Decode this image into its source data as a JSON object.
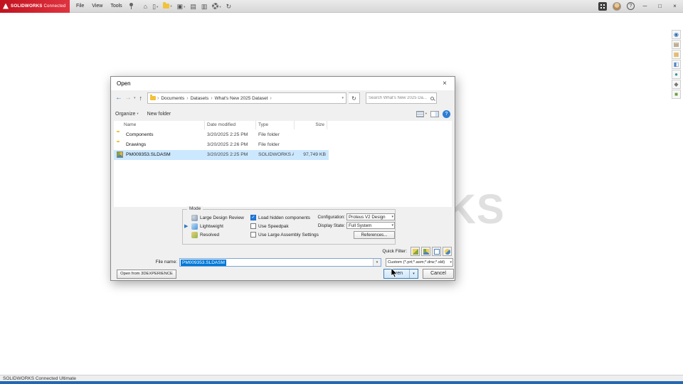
{
  "colors": {
    "accent_blue": "#0078d7",
    "selection_row": "#cce8ff",
    "brand_red": "#d42b1e",
    "taskbar_blue": "#2467b2"
  },
  "titlebar": {
    "brand": "SOLIDWORKS",
    "brand_suffix": " Connected",
    "menus": [
      "File",
      "View",
      "Tools"
    ]
  },
  "window_controls": {
    "help": "?",
    "minimize": "─",
    "restore": "□",
    "close": "×"
  },
  "quick_access_toolbar": {
    "icons": [
      {
        "name": "home-icon",
        "glyph": "⌂"
      },
      {
        "name": "new-document-icon",
        "glyph": "▯",
        "dropdown": true
      },
      {
        "name": "open-document-icon",
        "glyph": "#folder",
        "dropdown": true
      },
      {
        "name": "save-icon",
        "glyph": "▣",
        "dropdown": true
      },
      {
        "name": "print-icon",
        "glyph": "▤"
      },
      {
        "name": "paste-icon",
        "glyph": "▥"
      },
      {
        "name": "settings-icon",
        "glyph": "#gear",
        "dropdown": true
      },
      {
        "name": "rebuild-icon",
        "glyph": "↻"
      }
    ]
  },
  "task_pane": {
    "icons": [
      "3dexperience-icon",
      "design-library-icon",
      "file-explorer-icon",
      "view-palette-icon",
      "appearances-icon",
      "custom-properties-icon",
      "forum-icon"
    ],
    "glyphs": [
      "◉",
      "▤",
      "▦",
      "◧",
      "●",
      "◆",
      "■"
    ]
  },
  "watermark": "SOLIDWORKS",
  "statusbar": {
    "text": "SOLIDWORKS Connected Ultimate"
  },
  "dialog": {
    "title": "Open",
    "nav": {
      "breadcrumb": [
        "Documents",
        "Datasets",
        "What's New 2025 Dataset"
      ],
      "search_placeholder": "Search What's New 2025 Da..."
    },
    "commands": {
      "organize": "Organize",
      "new_folder": "New folder"
    },
    "columns": [
      "Name",
      "Date modified",
      "Type",
      "Size"
    ],
    "files": [
      {
        "name": "Components",
        "date": "3/20/2025 2:25 PM",
        "type": "File folder",
        "size": "",
        "icon": "folder",
        "selected": false
      },
      {
        "name": "Drawings",
        "date": "3/20/2025 2:26 PM",
        "type": "File folder",
        "size": "",
        "icon": "folder",
        "selected": false
      },
      {
        "name": "PM009353.SLDASM",
        "date": "3/20/2025 2:25 PM",
        "type": "SOLIDWORKS Ass...",
        "size": "97,749 KB",
        "icon": "assembly",
        "selected": true
      }
    ],
    "mode": {
      "label": "Mode",
      "options": [
        "Large Design Review",
        "Lightweight",
        "Resolved"
      ],
      "active_index": 1,
      "checkboxes": [
        {
          "label": "Load hidden components",
          "checked": true
        },
        {
          "label": "Use Speedpak",
          "checked": false
        },
        {
          "label": "Use Large Assembly Settings",
          "checked": false
        }
      ],
      "configuration_label": "Configuration:",
      "configuration_value": "Proteus V2 Design",
      "display_state_label": "Display State:",
      "display_state_value": "Full System",
      "references_button": "References..."
    },
    "quick_filter": {
      "label": "Quick Filter:",
      "buttons": [
        "filter-parts",
        "filter-assemblies",
        "filter-drawings",
        "filter-top-level-assemblies"
      ]
    },
    "file_name": {
      "label": "File name:",
      "value": "PM009353.SLDASM",
      "type_filter": "Custom (*.prt;*.asm;*.drw;*.sld)"
    },
    "buttons": {
      "open_from": "Open from 3DEXPERIENCE",
      "open": "Open",
      "cancel": "Cancel"
    }
  }
}
